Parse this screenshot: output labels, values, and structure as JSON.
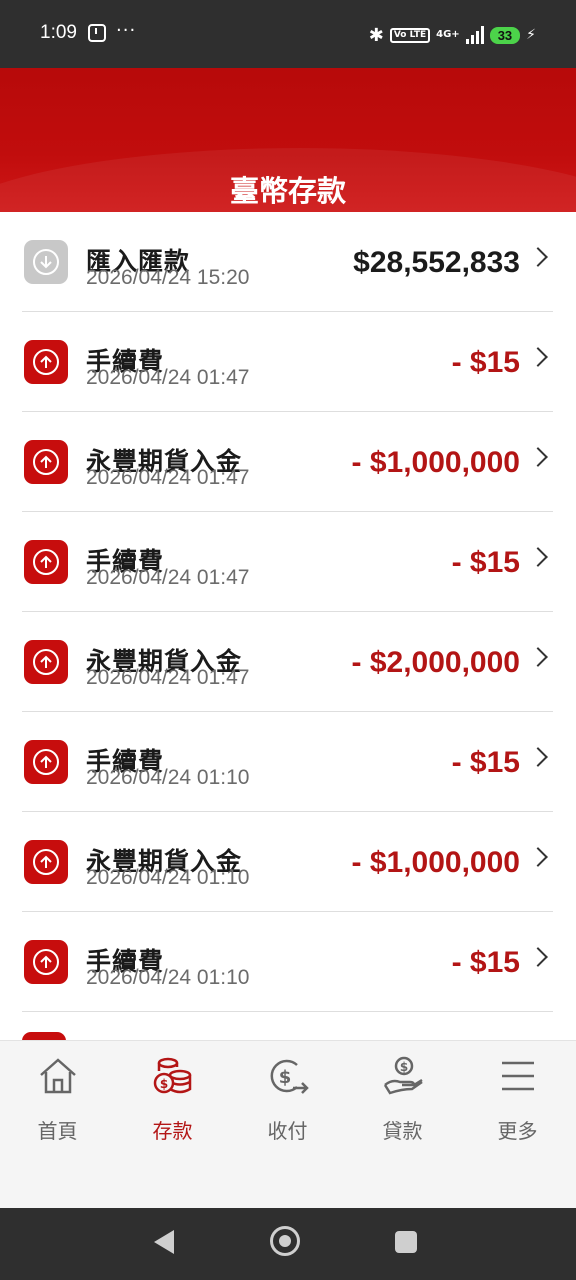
{
  "status_bar": {
    "time": "1:09",
    "more": "···",
    "volte": "Vo LTE",
    "network": "4G+",
    "battery": "33"
  },
  "header": {
    "title": "臺幣存款"
  },
  "transactions": [
    {
      "title": "匯入匯款",
      "datetime": "2026/04/24 15:20",
      "amount": "$28,552,833",
      "direction": "in"
    },
    {
      "title": "手續費",
      "datetime": "2026/04/24 01:47",
      "amount": "- $15",
      "direction": "out"
    },
    {
      "title": "永豐期貨入金",
      "datetime": "2026/04/24 01:47",
      "amount": "- $1,000,000",
      "direction": "out"
    },
    {
      "title": "手續費",
      "datetime": "2026/04/24 01:47",
      "amount": "- $15",
      "direction": "out"
    },
    {
      "title": "永豐期貨入金",
      "datetime": "2026/04/24 01:47",
      "amount": "- $2,000,000",
      "direction": "out"
    },
    {
      "title": "手續費",
      "datetime": "2026/04/24 01:10",
      "amount": "- $15",
      "direction": "out"
    },
    {
      "title": "永豐期貨入金",
      "datetime": "2026/04/24 01:10",
      "amount": "- $1,000,000",
      "direction": "out"
    },
    {
      "title": "手續費",
      "datetime": "2026/04/24 01:10",
      "amount": "- $15",
      "direction": "out"
    }
  ],
  "bottom_nav": {
    "items": [
      {
        "label": "首頁",
        "icon": "home-icon",
        "active": false
      },
      {
        "label": "存款",
        "icon": "coins-icon",
        "active": true
      },
      {
        "label": "收付",
        "icon": "dollar-transfer-icon",
        "active": false
      },
      {
        "label": "貸款",
        "icon": "loan-hand-icon",
        "active": false
      },
      {
        "label": "更多",
        "icon": "menu-icon",
        "active": false
      }
    ]
  },
  "colors": {
    "brand_red": "#c10d0d",
    "negative_amount": "#b31515",
    "battery_green": "#4cd34a"
  }
}
